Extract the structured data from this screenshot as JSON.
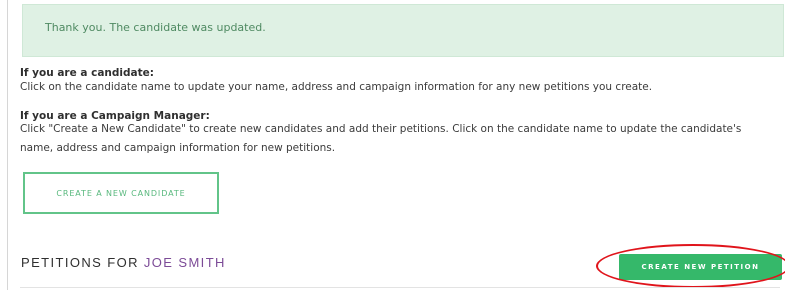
{
  "banner": {
    "message": "Thank you. The candidate was updated."
  },
  "candidate_section": {
    "heading": "If you are a candidate:",
    "text": "Click on the candidate name to update your name, address and campaign information for any new petitions you create."
  },
  "manager_section": {
    "heading": "If you are a Campaign Manager:",
    "text": "Click \"Create a New Candidate\" to create new candidates and add their petitions. Click on the candidate name to update the candidate's name, address and campaign information for new petitions."
  },
  "buttons": {
    "create_candidate": "CREATE A NEW CANDIDATE",
    "create_petition": "CREATE NEW PETITION"
  },
  "petitions": {
    "heading_prefix": "PETITIONS FOR ",
    "candidate_name": "JOE SMITH"
  },
  "colors": {
    "accent_green": "#35b86a",
    "banner_bg": "#dff1e4",
    "candidate_name": "#7c4b97",
    "annotation_red": "#e0141b"
  }
}
